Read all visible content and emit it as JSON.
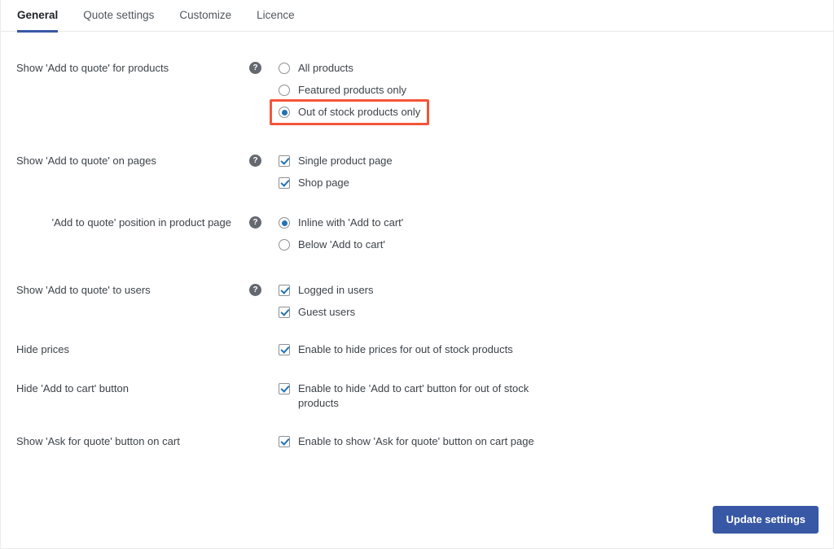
{
  "tabs": [
    {
      "label": "General",
      "active": true
    },
    {
      "label": "Quote settings",
      "active": false
    },
    {
      "label": "Customize",
      "active": false
    },
    {
      "label": "Licence",
      "active": false
    }
  ],
  "settings": [
    {
      "label": "Show 'Add to quote' for products",
      "has_help": true,
      "indented": false,
      "control": "radio",
      "options": [
        {
          "text": "All products",
          "checked": false,
          "highlighted": false
        },
        {
          "text": "Featured products only",
          "checked": false,
          "highlighted": false
        },
        {
          "text": "Out of stock products only",
          "checked": true,
          "highlighted": true
        }
      ]
    },
    {
      "label": "Show 'Add to quote' on pages",
      "has_help": true,
      "indented": false,
      "control": "checkbox",
      "options": [
        {
          "text": "Single product page",
          "checked": true,
          "highlighted": false
        },
        {
          "text": "Shop page",
          "checked": true,
          "highlighted": false
        }
      ]
    },
    {
      "label": "'Add to quote' position in product page",
      "has_help": true,
      "indented": true,
      "control": "radio",
      "options": [
        {
          "text": "Inline with 'Add to cart'",
          "checked": true,
          "highlighted": false
        },
        {
          "text": "Below 'Add to cart'",
          "checked": false,
          "highlighted": false
        }
      ]
    },
    {
      "label": "Show 'Add to quote' to users",
      "has_help": true,
      "indented": false,
      "control": "checkbox",
      "options": [
        {
          "text": "Logged in users",
          "checked": true,
          "highlighted": false
        },
        {
          "text": "Guest users",
          "checked": true,
          "highlighted": false
        }
      ]
    },
    {
      "label": "Hide prices",
      "has_help": false,
      "indented": false,
      "control": "checkbox",
      "options": [
        {
          "text": "Enable to hide prices for out of stock products",
          "checked": true,
          "highlighted": false
        }
      ]
    },
    {
      "label": "Hide 'Add to cart' button",
      "has_help": false,
      "indented": false,
      "control": "checkbox",
      "options": [
        {
          "text": "Enable to hide 'Add to cart' button for out of stock products",
          "checked": true,
          "highlighted": false
        }
      ]
    },
    {
      "label": "Show 'Ask for quote' button on cart",
      "has_help": false,
      "indented": false,
      "control": "checkbox",
      "options": [
        {
          "text": "Enable to show 'Ask for quote' button on cart page",
          "checked": true,
          "highlighted": false
        }
      ]
    }
  ],
  "footer": {
    "update_label": "Update settings"
  },
  "icons": {
    "help": "?"
  },
  "colors": {
    "accent_blue": "#3858a5",
    "control_blue": "#2271b1",
    "highlight_red": "#f4553a"
  }
}
